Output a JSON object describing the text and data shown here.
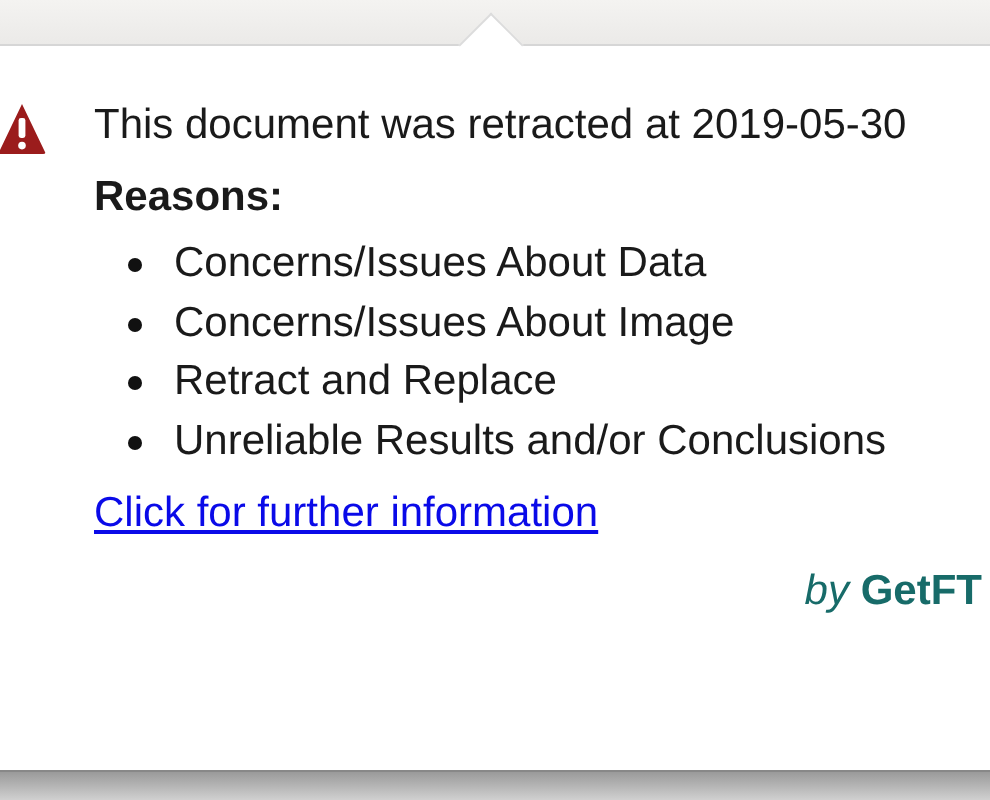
{
  "notice": {
    "message": "This document was retracted at 2019-05-30",
    "reasons_heading": "Reasons:",
    "reasons": [
      "Concerns/Issues About Data",
      "Concerns/Issues About Image",
      "Retract and Replace",
      "Unreliable Results and/or Conclusions"
    ],
    "link": "Click for further information",
    "credit": "*by* **GetFT**"
  }
}
